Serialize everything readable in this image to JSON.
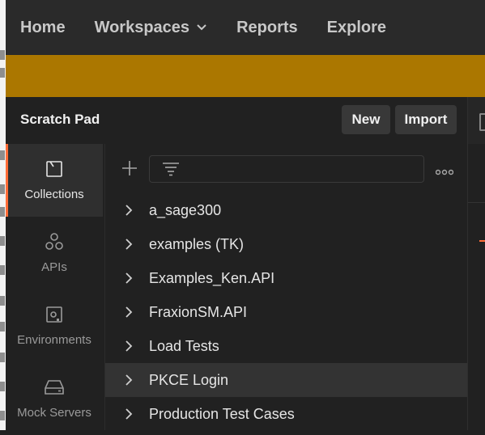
{
  "nav": {
    "items": [
      {
        "label": "Home"
      },
      {
        "label": "Workspaces",
        "has_dropdown": true
      },
      {
        "label": "Reports"
      },
      {
        "label": "Explore"
      }
    ]
  },
  "banner": {
    "color": "#ab7700"
  },
  "header": {
    "title": "Scratch Pad",
    "new_label": "New",
    "import_label": "Import"
  },
  "rail": {
    "items": [
      {
        "label": "Collections",
        "icon": "collection-icon",
        "active": true
      },
      {
        "label": "APIs",
        "icon": "apis-icon"
      },
      {
        "label": "Environments",
        "icon": "environment-icon"
      },
      {
        "label": "Mock Servers",
        "icon": "mock-server-icon"
      }
    ]
  },
  "collections": {
    "filter_placeholder": "",
    "items": [
      {
        "name": "a_sage300"
      },
      {
        "name": "examples (TK)"
      },
      {
        "name": "Examples_Ken.API"
      },
      {
        "name": "FraxionSM.API"
      },
      {
        "name": "Load Tests"
      },
      {
        "name": "PKCE Login",
        "hovered": true
      },
      {
        "name": "Production Test Cases"
      }
    ]
  },
  "colors": {
    "accent": "#ff6c37",
    "background": "#212121",
    "nav": "#2a2a2a"
  }
}
